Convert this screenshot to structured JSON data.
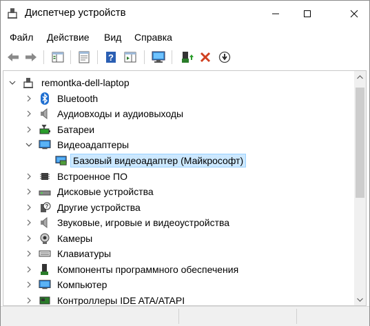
{
  "window": {
    "title": "Диспетчер устройств"
  },
  "menu": {
    "items": [
      {
        "label": "Файл"
      },
      {
        "label": "Действие"
      },
      {
        "label": "Вид"
      },
      {
        "label": "Справка"
      }
    ]
  },
  "toolbar": {
    "buttons": [
      {
        "icon": "back-arrow-icon"
      },
      {
        "icon": "forward-arrow-icon"
      },
      {
        "icon": "show-hide-console-tree-icon"
      },
      {
        "icon": "properties-icon"
      },
      {
        "icon": "help-icon"
      },
      {
        "icon": "action-pane-icon"
      },
      {
        "icon": "scan-hardware-icon"
      },
      {
        "icon": "update-driver-icon"
      },
      {
        "icon": "uninstall-device-icon"
      },
      {
        "icon": "disable-device-icon"
      }
    ]
  },
  "tree": {
    "root": {
      "label": "remontka-dell-laptop"
    },
    "categories": [
      {
        "label": "Bluetooth",
        "icon": "bluetooth-icon"
      },
      {
        "label": "Аудиовходы и аудиовыходы",
        "icon": "speaker-icon"
      },
      {
        "label": "Батареи",
        "icon": "battery-icon"
      },
      {
        "label": "Видеоадаптеры",
        "icon": "monitor-icon",
        "expanded": true,
        "children": [
          {
            "label": "Базовый видеоадаптер (Майкрософт)",
            "selected": true
          }
        ]
      },
      {
        "label": "Встроенное ПО",
        "icon": "chip-icon"
      },
      {
        "label": "Дисковые устройства",
        "icon": "disk-drive-icon"
      },
      {
        "label": "Другие устройства",
        "icon": "unknown-device-icon"
      },
      {
        "label": "Звуковые, игровые и видеоустройства",
        "icon": "speaker-icon"
      },
      {
        "label": "Камеры",
        "icon": "camera-icon"
      },
      {
        "label": "Клавиатуры",
        "icon": "keyboard-icon"
      },
      {
        "label": "Компоненты программного обеспечения",
        "icon": "software-component-icon"
      },
      {
        "label": "Компьютер",
        "icon": "computer-icon"
      },
      {
        "label": "Контроллеры IDE ATA/ATAPI",
        "icon": "ide-controller-icon"
      }
    ]
  },
  "colors": {
    "selection_bg": "#cce8ff",
    "selection_border": "#99d1ff",
    "bluetooth": "#1f6fd1",
    "uninstall_red": "#d04020"
  }
}
